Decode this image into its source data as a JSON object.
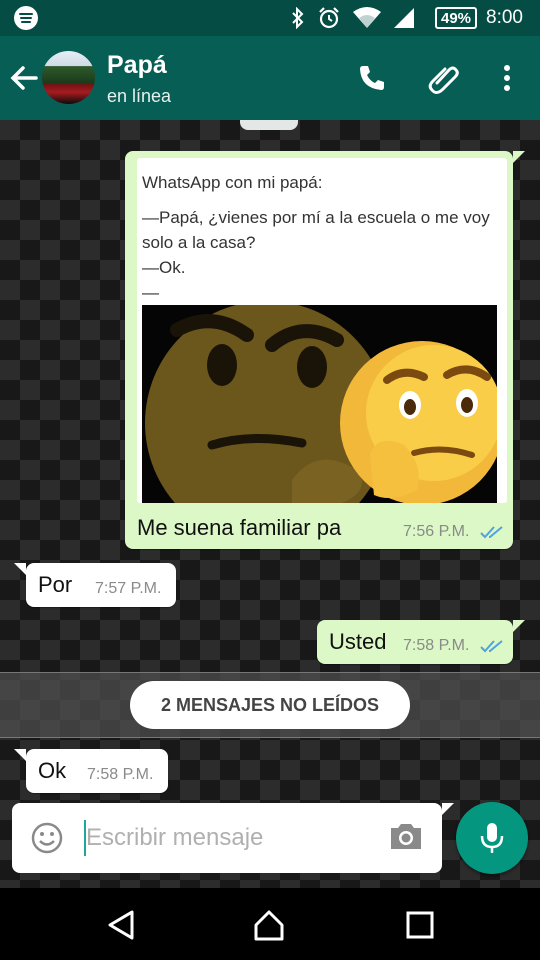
{
  "status_bar": {
    "battery": "49%",
    "time": "8:00",
    "icons": [
      "spotify-icon",
      "bluetooth-icon",
      "alarm-icon",
      "wifi-icon",
      "signal-icon",
      "battery-icon"
    ]
  },
  "header": {
    "contact_name": "Papá",
    "contact_status": "en línea",
    "icons": [
      "back-arrow-icon",
      "phone-icon",
      "paperclip-icon",
      "more-vert-icon"
    ]
  },
  "messages": [
    {
      "direction": "out",
      "quote": {
        "title": "WhatsApp con mi papá:",
        "lines": [
          "—Papá, ¿vienes por mí a la escuela o me voy solo a la casa?",
          "—Ok.",
          "—"
        ],
        "image": "thinking-face-emojis"
      },
      "text": "Me suena familiar pa",
      "time": "7:56 P.M.",
      "status": "read"
    },
    {
      "direction": "in",
      "text": "Por",
      "time": "7:57 P.M."
    },
    {
      "direction": "out",
      "text": "Usted",
      "time": "7:58 P.M.",
      "status": "read"
    },
    {
      "direction": "in",
      "text": "Ok",
      "time": "7:58 P.M."
    }
  ],
  "unread_banner": "2 MENSAJES NO LEÍDOS",
  "composer": {
    "placeholder": "Escribir mensaje",
    "icons": [
      "emoji-icon",
      "camera-icon",
      "microphone-icon"
    ]
  },
  "colors": {
    "header": "#075e54",
    "status_bar": "#054d44",
    "outgoing_bubble": "#dcf8c6",
    "incoming_bubble": "#ffffff",
    "read_ticks": "#4fc3f7",
    "mic_button": "#05967f"
  }
}
